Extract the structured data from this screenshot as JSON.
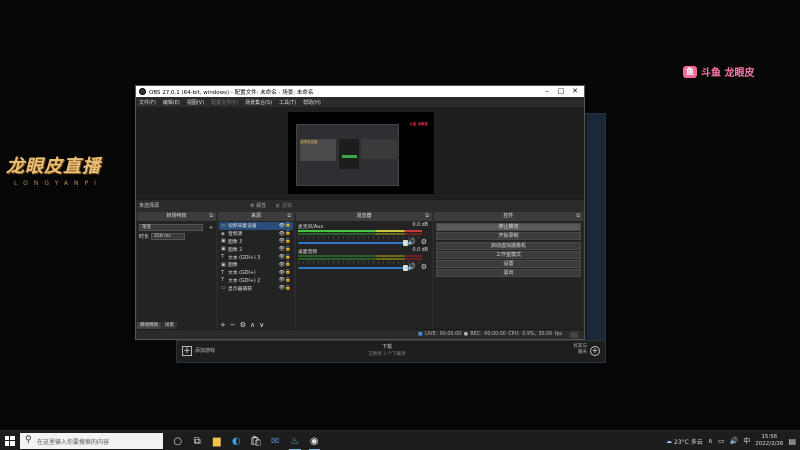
{
  "overlay": {
    "logo_main": "龙眼皮直播",
    "logo_sub": "LONGYANPI",
    "douyu_badge": "斗鱼",
    "douyu_text": "斗鱼 龙眼皮"
  },
  "background_window": {
    "add_game": "添加游戏",
    "download_title": "下载",
    "download_sub": "已暂停 3 个下载项",
    "friends": "好友与\n聊天"
  },
  "obs": {
    "title": "OBS 27.0.1 (64-bit, windows) - 配置文件: 未命名 - 场景: 未命名",
    "menu": [
      {
        "label": "文件(F)",
        "enabled": true
      },
      {
        "label": "编辑(E)",
        "enabled": true
      },
      {
        "label": "视图(V)",
        "enabled": true
      },
      {
        "label": "配置文件(P)",
        "enabled": false
      },
      {
        "label": "场景集合(S)",
        "enabled": true
      },
      {
        "label": "工具(T)",
        "enabled": true
      },
      {
        "label": "帮助(H)",
        "enabled": true
      }
    ],
    "preview_tag": "龙眼皮直播",
    "preview_red": "斗鱼 龙眼皮",
    "scene_bar": {
      "no_scene": "未选择源",
      "properties": "属性",
      "filters": "滤镜"
    },
    "docks": {
      "transitions": {
        "title": "转场特效",
        "type_value": "渐变",
        "duration_label": "时长",
        "duration_value": "250 ms",
        "tab_transitions": "转场特效",
        "tab_scenes": "场景"
      },
      "sources": {
        "title": "来源",
        "items": [
          {
            "icon": "▭",
            "name": "视频采集设备",
            "selected": true
          },
          {
            "icon": "◈",
            "name": "音频源",
            "selected": false
          },
          {
            "icon": "▣",
            "name": "图像 3",
            "selected": false
          },
          {
            "icon": "▣",
            "name": "图像 2",
            "selected": false
          },
          {
            "icon": "T",
            "name": "文本 (GDI+) 3",
            "selected": false
          },
          {
            "icon": "▣",
            "name": "图像",
            "selected": false
          },
          {
            "icon": "T",
            "name": "文本 (GDI+)",
            "selected": false
          },
          {
            "icon": "T",
            "name": "文本 (GDI+) 2",
            "selected": false
          },
          {
            "icon": "▭",
            "name": "显示器捕获",
            "selected": false
          }
        ]
      },
      "mixer": {
        "title": "混音器",
        "channels": [
          {
            "name": "麦克风/Aux",
            "db": "0.0 dB"
          },
          {
            "name": "桌面音频",
            "db": "0.0 dB"
          }
        ]
      },
      "controls": {
        "title": "控件",
        "buttons": [
          "停止推流",
          "开始录制",
          "启动虚拟摄像机",
          "工作室模式",
          "设置",
          "退出"
        ]
      }
    },
    "status": {
      "live_label": "LIVE:",
      "live_time": "00:00:00",
      "rec_label": "REC:",
      "rec_time": "00:00:00",
      "cpu": "CPU: 0.9%, 30.00 fps"
    }
  },
  "taskbar": {
    "search_placeholder": "在这里输入你要搜索的内容",
    "weather": "23°C 多云",
    "ime": "中",
    "time": "15:56",
    "date": "2022/2/26"
  }
}
